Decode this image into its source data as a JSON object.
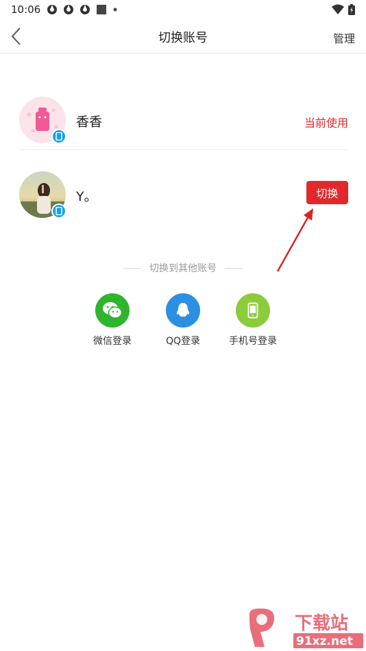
{
  "status_bar": {
    "time": "10:06",
    "icons": [
      "app-icon",
      "app-icon",
      "app-icon",
      "square-icon",
      "dot-icon"
    ],
    "right_icons": [
      "wifi-icon",
      "battery-icon"
    ]
  },
  "nav": {
    "back_icon": "chevron-left-icon",
    "title": "切换账号",
    "manage_label": "管理"
  },
  "accounts": [
    {
      "name": "香香",
      "status_label": "当前使用",
      "avatar": "pink-cartoon-avatar",
      "badge_icon": "phone-icon"
    },
    {
      "name": "Y。",
      "action_label": "切换",
      "avatar": "photo-avatar",
      "badge_icon": "phone-icon"
    }
  ],
  "other_login": {
    "divider_text": "切换到其他账号",
    "options": [
      {
        "label": "微信登录",
        "icon": "wechat-icon",
        "color": "#2fb52d"
      },
      {
        "label": "QQ登录",
        "icon": "qq-icon",
        "color": "#2c8fe2"
      },
      {
        "label": "手机号登录",
        "icon": "phone-icon",
        "color": "#8ccb3a"
      }
    ]
  },
  "watermark": {
    "line1": "下载站",
    "line2": "91xz.net"
  },
  "colors": {
    "accent": "#e2282a",
    "badge": "#1aa0e8"
  }
}
